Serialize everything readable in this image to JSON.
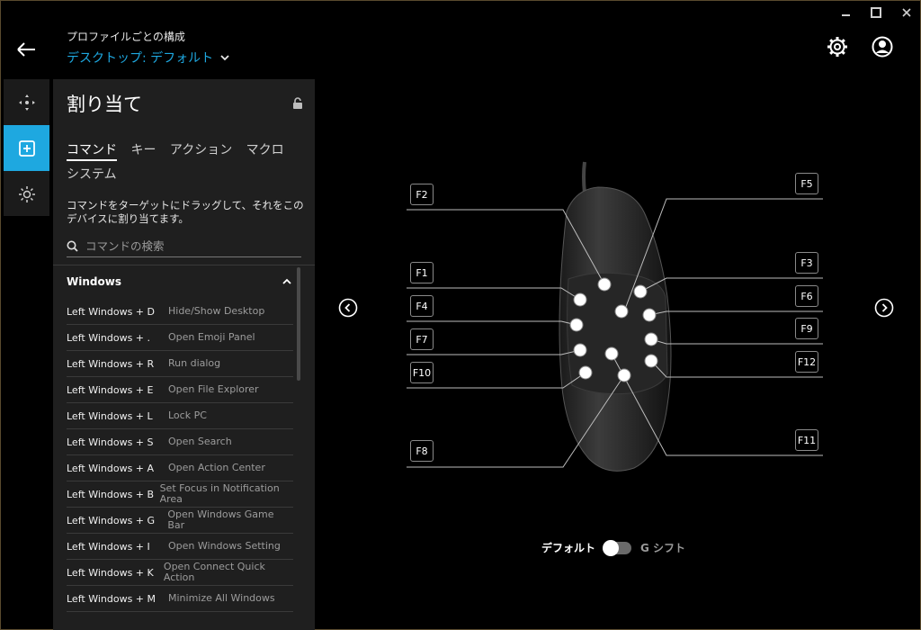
{
  "header": {
    "subtitle": "プロファイルごとの構成",
    "profile": "デスクトップ: デフォルト"
  },
  "panel": {
    "title": "割り当て",
    "tabs": [
      "コマンド",
      "キー",
      "アクション",
      "マクロ",
      "システム"
    ],
    "active_tab": "コマンド",
    "instructions": "コマンドをターゲットにドラッグして、それをこのデバイスに割り当てます。",
    "search_placeholder": "コマンドの検索",
    "group_title": "Windows",
    "commands": [
      {
        "key": "Left Windows + D",
        "desc": "Hide/Show Desktop"
      },
      {
        "key": "Left Windows + .",
        "desc": "Open Emoji Panel"
      },
      {
        "key": "Left Windows + R",
        "desc": "Run dialog"
      },
      {
        "key": "Left Windows + E",
        "desc": "Open File Explorer"
      },
      {
        "key": "Left Windows + L",
        "desc": "Lock PC"
      },
      {
        "key": "Left Windows + S",
        "desc": "Open Search"
      },
      {
        "key": "Left Windows + A",
        "desc": "Open Action Center"
      },
      {
        "key": "Left Windows + B",
        "desc": "Set Focus in Notification Area"
      },
      {
        "key": "Left Windows + G",
        "desc": "Open Windows Game Bar"
      },
      {
        "key": "Left Windows + I",
        "desc": "Open Windows Setting"
      },
      {
        "key": "Left Windows + K",
        "desc": "Open Connect Quick Action"
      },
      {
        "key": "Left Windows + M",
        "desc": "Minimize All Windows"
      }
    ]
  },
  "fkeys": {
    "f1": "F1",
    "f2": "F2",
    "f3": "F3",
    "f4": "F4",
    "f5": "F5",
    "f6": "F6",
    "f7": "F7",
    "f8": "F8",
    "f9": "F9",
    "f10": "F10",
    "f11": "F11",
    "f12": "F12"
  },
  "toggle": {
    "left_label": "デフォルト",
    "right_label": "G シフト",
    "state": "off"
  },
  "colors": {
    "accent": "#1ea8e0",
    "background": "#000000",
    "panel": "#1f1f1f"
  }
}
